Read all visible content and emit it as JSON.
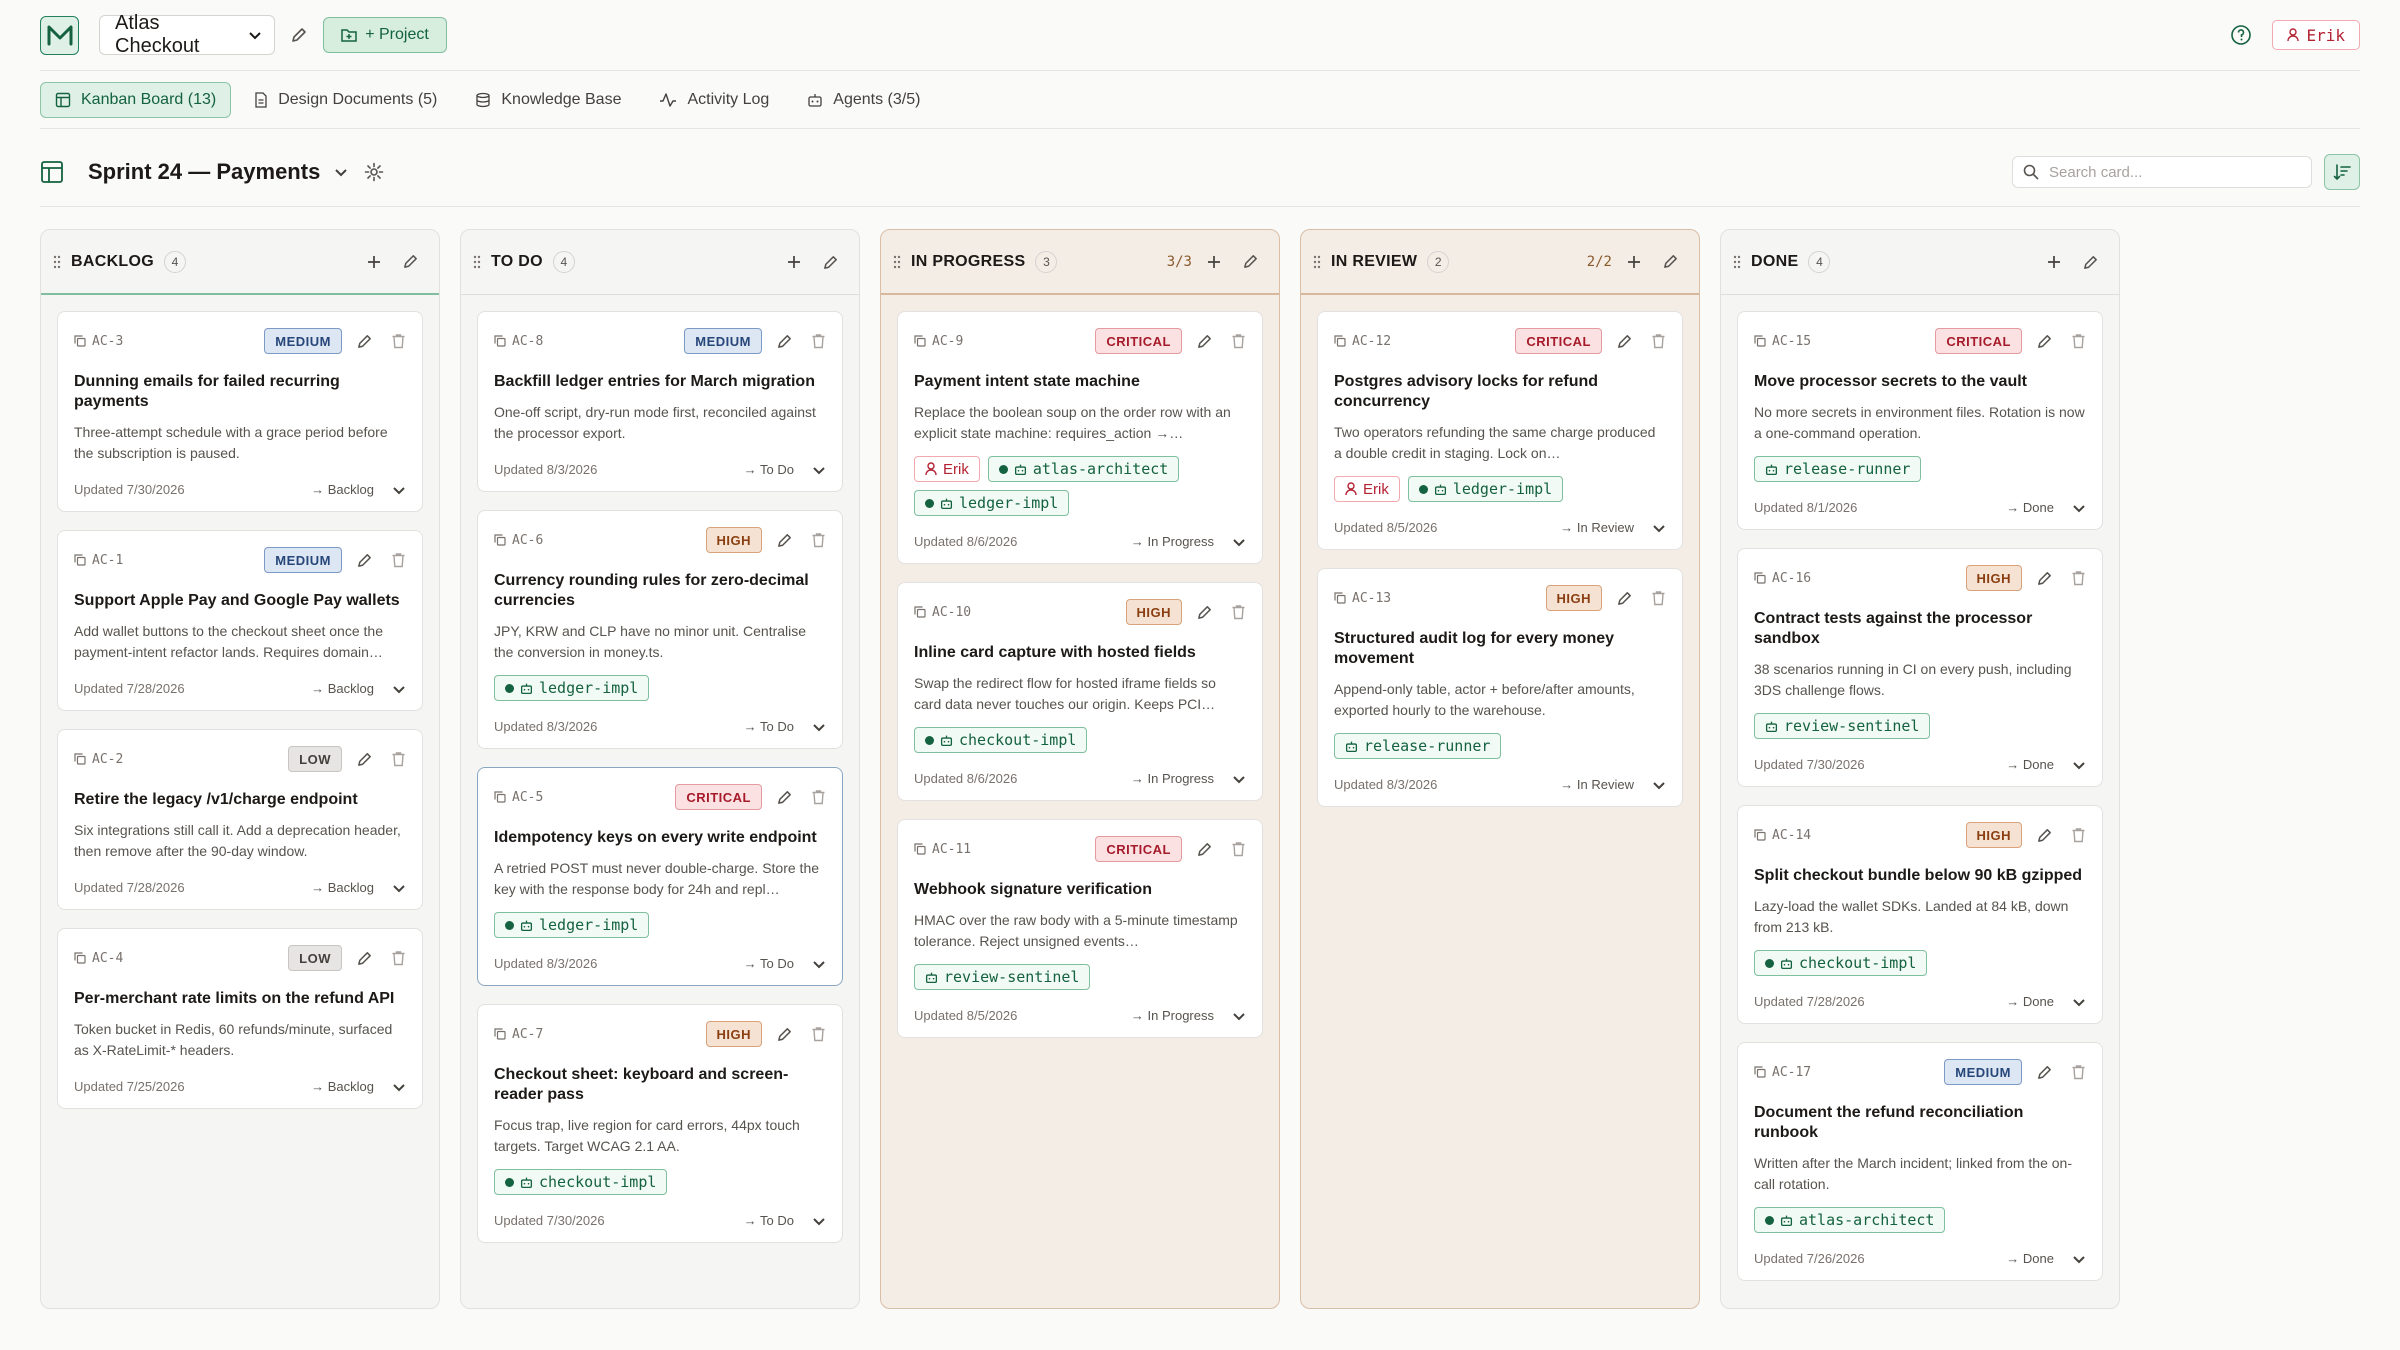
{
  "header": {
    "project_name": "Atlas Checkout",
    "add_project_label": "+ Project",
    "user_name": "Erik"
  },
  "tabs": [
    {
      "label": "Kanban Board (13)",
      "active": true,
      "icon": "kanban-icon"
    },
    {
      "label": "Design Documents (5)",
      "icon": "document-icon"
    },
    {
      "label": "Knowledge Base",
      "icon": "database-icon"
    },
    {
      "label": "Activity Log",
      "icon": "activity-icon"
    },
    {
      "label": "Agents (3/5)",
      "icon": "robot-icon"
    }
  ],
  "board": {
    "title": "Sprint 24 — Payments",
    "search_placeholder": "Search card..."
  },
  "columns": [
    {
      "name": "BACKLOG",
      "count": "4",
      "wip": "",
      "cards": [
        {
          "id": "AC-3",
          "priority": "MEDIUM",
          "title": "Dunning emails for failed recurring payments",
          "desc": "Three-attempt schedule with a grace period before the subscription is paused.",
          "chips": [],
          "updated": "Updated 7/30/2026",
          "status": "→ Backlog"
        },
        {
          "id": "AC-1",
          "priority": "MEDIUM",
          "title": "Support Apple Pay and Google Pay wallets",
          "desc": "Add wallet buttons to the checkout sheet once the payment-intent refactor lands. Requires domain…",
          "chips": [],
          "updated": "Updated 7/28/2026",
          "status": "→ Backlog"
        },
        {
          "id": "AC-2",
          "priority": "LOW",
          "title": "Retire the legacy /v1/charge endpoint",
          "desc": "Six integrations still call it. Add a deprecation header, then remove after the 90-day window.",
          "chips": [],
          "updated": "Updated 7/28/2026",
          "status": "→ Backlog"
        },
        {
          "id": "AC-4",
          "priority": "LOW",
          "title": "Per-merchant rate limits on the refund API",
          "desc": "Token bucket in Redis, 60 refunds/minute, surfaced as X-RateLimit-* headers.",
          "chips": [],
          "updated": "Updated 7/25/2026",
          "status": "→ Backlog"
        }
      ]
    },
    {
      "name": "TO DO",
      "count": "4",
      "wip": "",
      "cards": [
        {
          "id": "AC-8",
          "priority": "MEDIUM",
          "title": "Backfill ledger entries for March migration",
          "desc": "One-off script, dry-run mode first, reconciled against the processor export.",
          "chips": [],
          "updated": "Updated 8/3/2026",
          "status": "→ To Do"
        },
        {
          "id": "AC-6",
          "priority": "HIGH",
          "title": "Currency rounding rules for zero-decimal currencies",
          "desc": "JPY, KRW and CLP have no minor unit. Centralise the conversion in money.ts.",
          "chips": [
            {
              "type": "agent",
              "label": "ledger-impl",
              "active": true
            }
          ],
          "updated": "Updated 8/3/2026",
          "status": "→ To Do"
        },
        {
          "id": "AC-5",
          "priority": "CRITICAL",
          "title": "Idempotency keys on every write endpoint",
          "desc": "A retried POST must never double-charge. Store the key with the response body for 24h and repl…",
          "chips": [
            {
              "type": "agent",
              "label": "ledger-impl",
              "active": true
            }
          ],
          "updated": "Updated 8/3/2026",
          "status": "→ To Do",
          "selected": true
        },
        {
          "id": "AC-7",
          "priority": "HIGH",
          "title": "Checkout sheet: keyboard and screen-reader pass",
          "desc": "Focus trap, live region for card errors, 44px touch targets. Target WCAG 2.1 AA.",
          "chips": [
            {
              "type": "agent",
              "label": "checkout-impl",
              "active": true
            }
          ],
          "updated": "Updated 7/30/2026",
          "status": "→ To Do"
        }
      ]
    },
    {
      "name": "IN PROGRESS",
      "count": "3",
      "wip": "3/3",
      "highlight": true,
      "cards": [
        {
          "id": "AC-9",
          "priority": "CRITICAL",
          "title": "Payment intent state machine",
          "desc": "Replace the boolean soup on the order row with an explicit state machine: requires_action →…",
          "chips": [
            {
              "type": "user",
              "label": "Erik"
            },
            {
              "type": "agent",
              "label": "atlas-architect",
              "active": true
            },
            {
              "type": "agent",
              "label": "ledger-impl",
              "active": true
            }
          ],
          "updated": "Updated 8/6/2026",
          "status": "→ In Progress"
        },
        {
          "id": "AC-10",
          "priority": "HIGH",
          "title": "Inline card capture with hosted fields",
          "desc": "Swap the redirect flow for hosted iframe fields so card data never touches our origin. Keeps PCI…",
          "chips": [
            {
              "type": "agent",
              "label": "checkout-impl",
              "active": true
            }
          ],
          "updated": "Updated 8/6/2026",
          "status": "→ In Progress"
        },
        {
          "id": "AC-11",
          "priority": "CRITICAL",
          "title": "Webhook signature verification",
          "desc": "HMAC over the raw body with a 5-minute timestamp tolerance. Reject unsigned events…",
          "chips": [
            {
              "type": "agent",
              "label": "review-sentinel",
              "active": false
            }
          ],
          "updated": "Updated 8/5/2026",
          "status": "→ In Progress"
        }
      ]
    },
    {
      "name": "IN REVIEW",
      "count": "2",
      "wip": "2/2",
      "highlight": true,
      "cards": [
        {
          "id": "AC-12",
          "priority": "CRITICAL",
          "title": "Postgres advisory locks for refund concurrency",
          "desc": "Two operators refunding the same charge produced a double credit in staging. Lock on…",
          "chips": [
            {
              "type": "user",
              "label": "Erik"
            },
            {
              "type": "agent",
              "label": "ledger-impl",
              "active": true
            }
          ],
          "updated": "Updated 8/5/2026",
          "status": "→ In Review"
        },
        {
          "id": "AC-13",
          "priority": "HIGH",
          "title": "Structured audit log for every money movement",
          "desc": "Append-only table, actor + before/after amounts, exported hourly to the warehouse.",
          "chips": [
            {
              "type": "agent",
              "label": "release-runner",
              "active": false
            }
          ],
          "updated": "Updated 8/3/2026",
          "status": "→ In Review"
        }
      ]
    },
    {
      "name": "DONE",
      "count": "4",
      "wip": "",
      "cards": [
        {
          "id": "AC-15",
          "priority": "CRITICAL",
          "title": "Move processor secrets to the vault",
          "desc": "No more secrets in environment files. Rotation is now a one-command operation.",
          "chips": [
            {
              "type": "agent",
              "label": "release-runner",
              "active": false
            }
          ],
          "updated": "Updated 8/1/2026",
          "status": "→ Done"
        },
        {
          "id": "AC-16",
          "priority": "HIGH",
          "title": "Contract tests against the processor sandbox",
          "desc": "38 scenarios running in CI on every push, including 3DS challenge flows.",
          "chips": [
            {
              "type": "agent",
              "label": "review-sentinel",
              "active": false
            }
          ],
          "updated": "Updated 7/30/2026",
          "status": "→ Done"
        },
        {
          "id": "AC-14",
          "priority": "HIGH",
          "title": "Split checkout bundle below 90 kB gzipped",
          "desc": "Lazy-load the wallet SDKs. Landed at 84 kB, down from 213 kB.",
          "chips": [
            {
              "type": "agent",
              "label": "checkout-impl",
              "active": true
            }
          ],
          "updated": "Updated 7/28/2026",
          "status": "→ Done"
        },
        {
          "id": "AC-17",
          "priority": "MEDIUM",
          "title": "Document the refund reconciliation runbook",
          "desc": "Written after the March incident; linked from the on-call rotation.",
          "chips": [
            {
              "type": "agent",
              "label": "atlas-architect",
              "active": true
            }
          ],
          "updated": "Updated 7/26/2026",
          "status": "→ Done"
        }
      ]
    }
  ],
  "colors": {
    "accent": "#14623f",
    "accent_bg": "#dff0e6",
    "user": "#b42334",
    "critical": "#a61b2b",
    "high": "#8a3f12",
    "medium": "#27467a"
  }
}
